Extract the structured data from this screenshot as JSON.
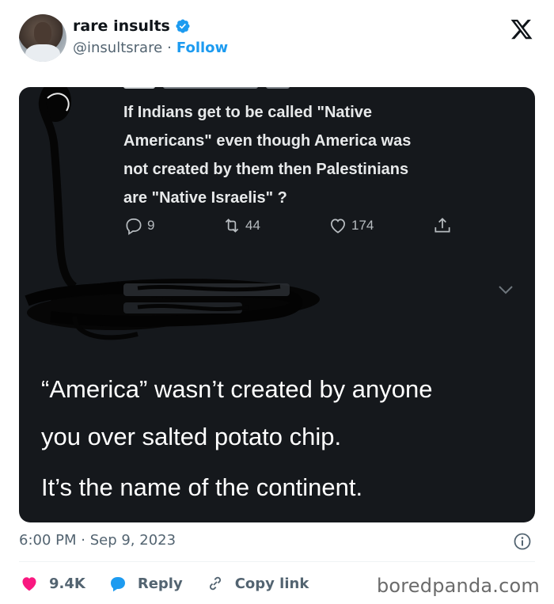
{
  "author": {
    "display_name": "rare insults",
    "handle": "@insultsrare",
    "separator": "·",
    "follow_label": "Follow",
    "verified": true
  },
  "embedded_tweet": {
    "text_lines": [
      "If Indians get to be called \"Native",
      "Americans\" even though America was",
      "not created by them then Palestinians",
      "are \"Native Israelis\" ?"
    ],
    "replies": "9",
    "retweets": "44",
    "likes": "174"
  },
  "reply_tweet": {
    "lines": [
      "“America” wasn’t created by anyone",
      "you over salted potato chip.",
      "It’s the name of the continent."
    ]
  },
  "meta": {
    "timestamp": "6:00 PM · Sep 9, 2023"
  },
  "footer": {
    "like_count": "9.4K",
    "reply_label": "Reply",
    "copy_link_label": "Copy link",
    "brand": "boredpanda.com"
  },
  "colors": {
    "accent": "#1d9bf0",
    "like": "#f91880",
    "media_bg": "#15181c"
  },
  "icons": [
    "verified-badge-icon",
    "x-logo-icon",
    "comment-icon",
    "retweet-icon",
    "heart-icon",
    "share-icon",
    "chevron-down-icon",
    "info-icon",
    "chat-bubble-icon",
    "link-icon"
  ]
}
